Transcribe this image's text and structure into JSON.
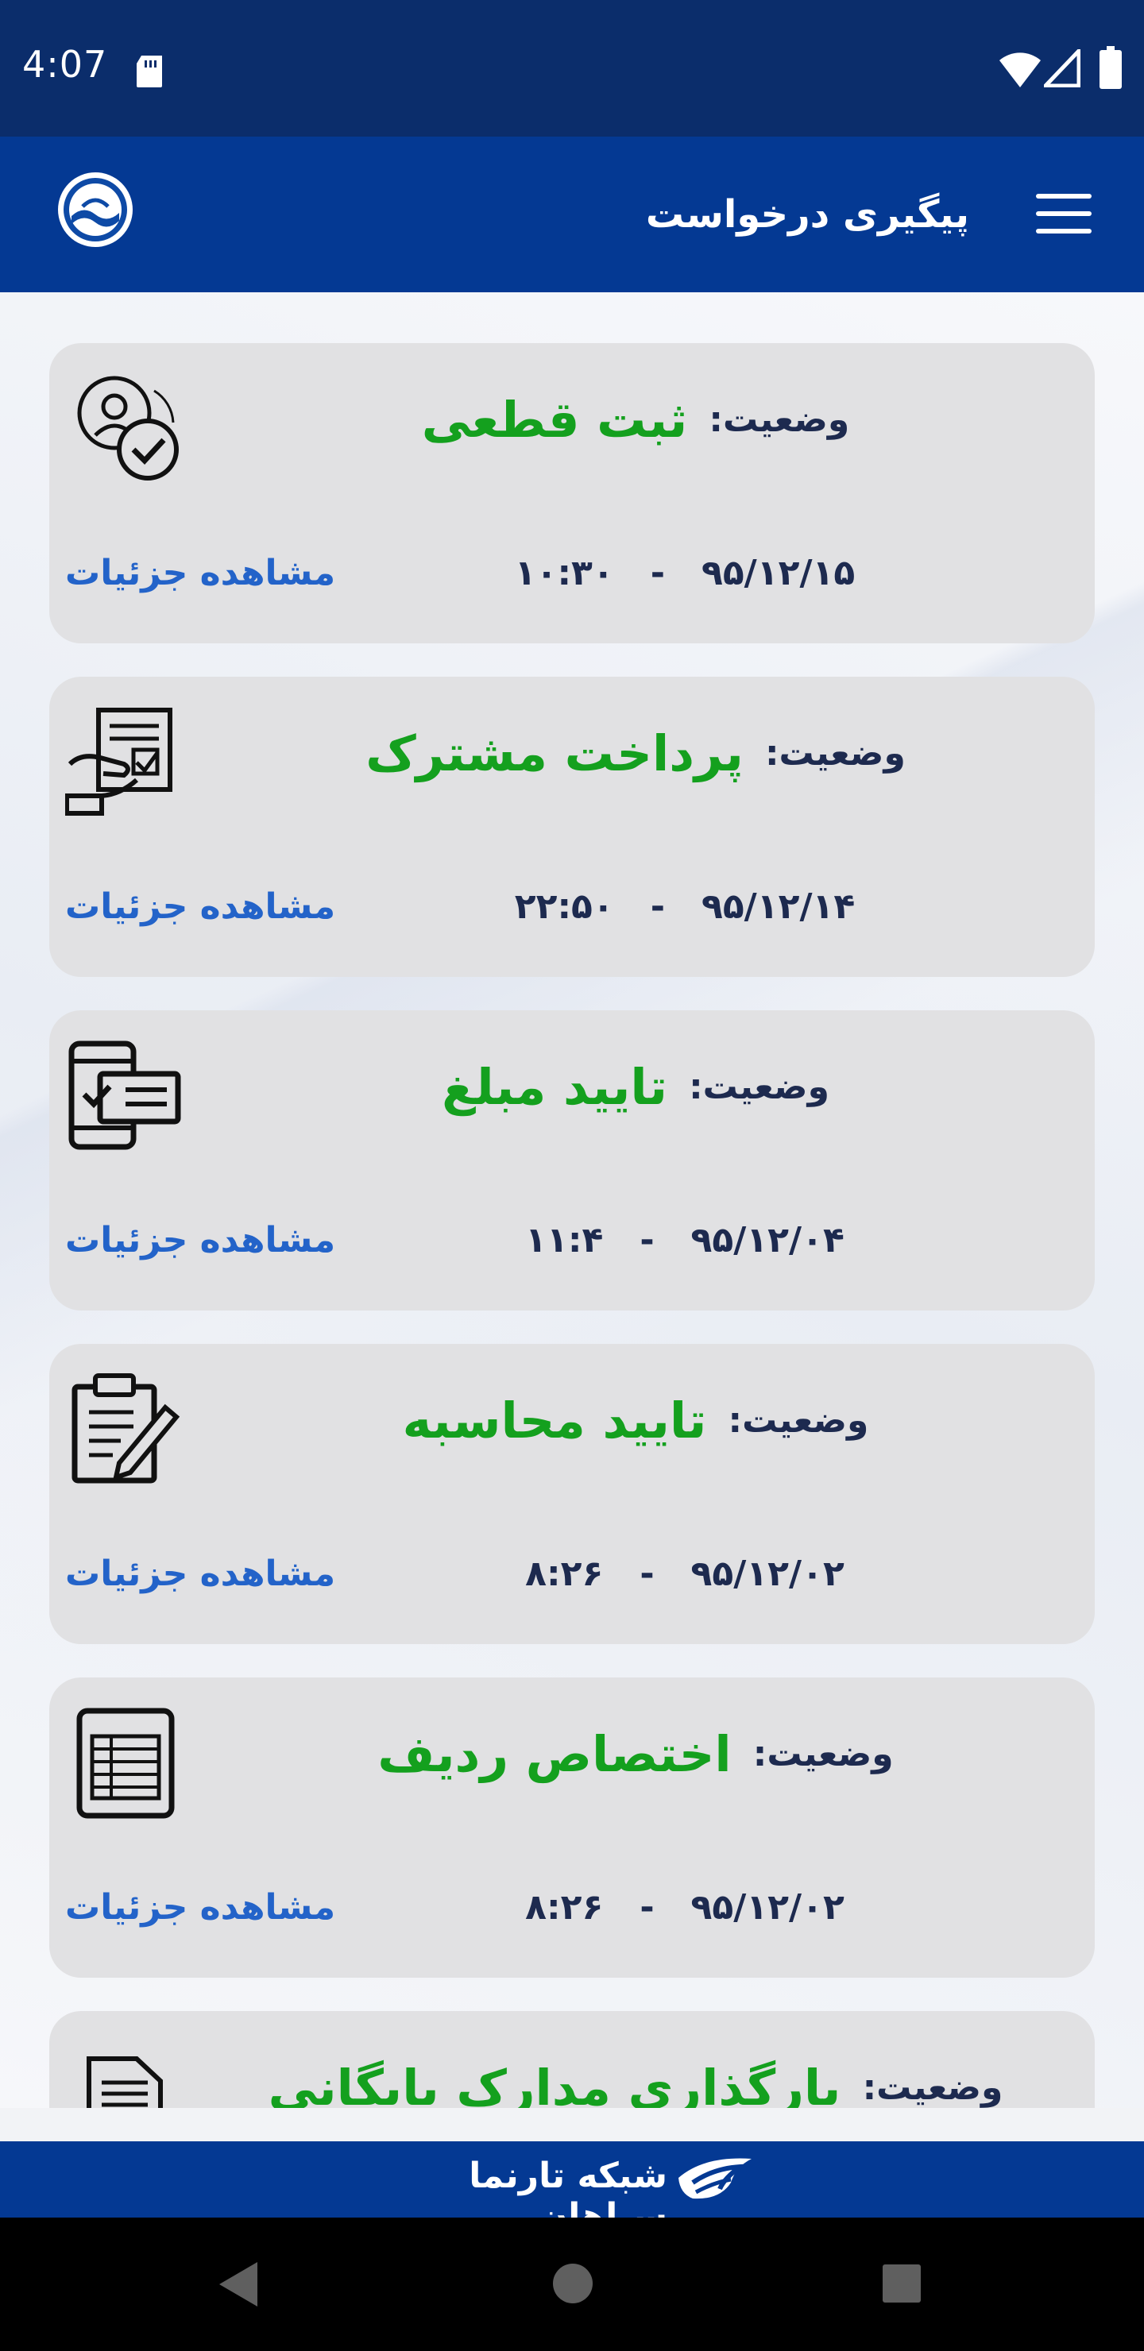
{
  "status_bar": {
    "time": "4:07"
  },
  "app_bar": {
    "title": "پیگیری درخواست"
  },
  "requests": [
    {
      "icon": "user-check-icon",
      "status_label": "وضعیت:",
      "status": "ثبت قطعی",
      "date": "۹۵/۱۲/۱۵",
      "separator": "-",
      "time": "۱۰:۳۰",
      "details_label": "مشاهده جزئیات"
    },
    {
      "icon": "document-hand-icon",
      "status_label": "وضعیت:",
      "status": "پرداخت مشترک",
      "date": "۹۵/۱۲/۱۴",
      "separator": "-",
      "time": "۲۲:۵۰",
      "details_label": "مشاهده جزئیات"
    },
    {
      "icon": "mobile-card-check-icon",
      "status_label": "وضعیت:",
      "status": "تایید مبلغ",
      "date": "۹۵/۱۲/۰۴",
      "separator": "-",
      "time": "۱۱:۴",
      "details_label": "مشاهده جزئیات"
    },
    {
      "icon": "clipboard-pen-icon",
      "status_label": "وضعیت:",
      "status": "تایید محاسبه",
      "date": "۹۵/۱۲/۰۲",
      "separator": "-",
      "time": "۸:۲۶",
      "details_label": "مشاهده جزئیات"
    },
    {
      "icon": "spreadsheet-icon",
      "status_label": "وضعیت:",
      "status": "اختصاص ردیف",
      "date": "۹۵/۱۲/۰۲",
      "separator": "-",
      "time": "۸:۲۶",
      "details_label": "مشاهده جزئیات"
    },
    {
      "icon": "document-upload-icon",
      "status_label": "وضعیت:",
      "status": "بارگذاری مدارک بایگانی",
      "date": "",
      "separator": "",
      "time": "",
      "details_label": ""
    }
  ],
  "footer": {
    "text": "شبکه تارنما سپاهان"
  },
  "colors": {
    "status_bar": "#0b2d6b",
    "app_bar": "#043993",
    "card": "#e1e1e3",
    "status_value": "#14a01e",
    "link": "#2363c9",
    "text_dark": "#1d2a4f"
  }
}
